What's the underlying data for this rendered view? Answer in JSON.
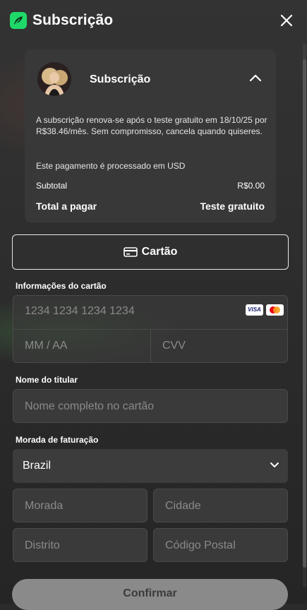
{
  "header": {
    "title": "Subscrição",
    "logo_icon": "leaf-logo-icon",
    "close_icon": "close-icon"
  },
  "summary": {
    "title": "Subscrição",
    "renew_text": "A subscrição renova-se após o teste gratuito em 18/10/25 por R$38.46/mês. Sem compromisso, cancela quando quiseres.",
    "processed_text": "Este pagamento é processado em USD",
    "subtotal_label": "Subtotal",
    "subtotal_value": "R$0.00",
    "total_label": "Total a pagar",
    "total_value": "Teste gratuito"
  },
  "payment_method": {
    "label": "Cartão",
    "icon": "credit-card-icon"
  },
  "card_info": {
    "label": "Informações do cartão",
    "number_placeholder": "1234 1234 1234 1234",
    "expiry_placeholder": "MM / AA",
    "cvv_placeholder": "CVV",
    "brands": [
      "VISA",
      "Mastercard"
    ]
  },
  "holder": {
    "label": "Nome do titular",
    "placeholder": "Nome completo no cartão"
  },
  "billing": {
    "label": "Morada de faturação",
    "country": "Brazil",
    "address_placeholder": "Morada",
    "city_placeholder": "Cidade",
    "district_placeholder": "Distrito",
    "postal_placeholder": "Código Postal"
  },
  "confirm": {
    "label": "Confirmar"
  },
  "colors": {
    "accent": "#1fd86a",
    "surface": "#383838",
    "button_disabled": "#8a8a8a"
  }
}
